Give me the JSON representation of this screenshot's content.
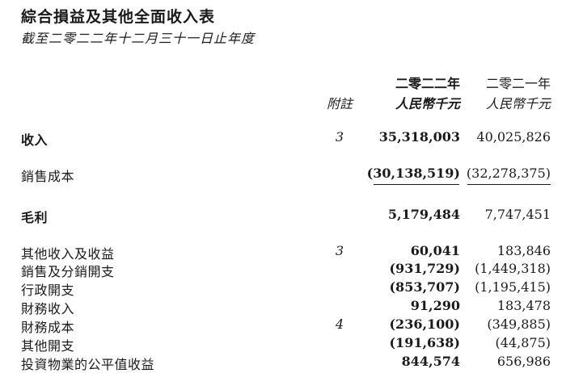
{
  "title": "綜合損益及其他全面收入表",
  "subtitle": "截至二零二二年十二月三十一日止年度",
  "header": {
    "note": "附註",
    "year_2022": "二零二二年",
    "year_2021": "二零二一年",
    "unit_2022": "人民幣千元",
    "unit_2021": "人民幣千元"
  },
  "rows": [
    {
      "label": "收入",
      "note": "3",
      "v2022": "35,318,003",
      "v2021": "40,025,826"
    },
    {
      "label": "銷售成本",
      "note": "",
      "v2022": "(30,138,519)",
      "v2021": "(32,278,375)"
    },
    {
      "label": "毛利",
      "note": "",
      "v2022": "5,179,484",
      "v2021": "7,747,451"
    },
    {
      "label": "其他收入及收益",
      "note": "3",
      "v2022": "60,041",
      "v2021": "183,846"
    },
    {
      "label": "銷售及分銷開支",
      "note": "",
      "v2022": "(931,729)",
      "v2021": "(1,449,318)"
    },
    {
      "label": "行政開支",
      "note": "",
      "v2022": "(853,707)",
      "v2021": "(1,195,415)"
    },
    {
      "label": "財務收入",
      "note": "",
      "v2022": "91,290",
      "v2021": "183,478"
    },
    {
      "label": "財務成本",
      "note": "4",
      "v2022": "(236,100)",
      "v2021": "(349,885)"
    },
    {
      "label": "其他開支",
      "note": "",
      "v2022": "(191,638)",
      "v2021": "(44,875)"
    },
    {
      "label": "投資物業的公平值收益",
      "note": "",
      "v2022": "844,574",
      "v2021": "656,986"
    }
  ]
}
